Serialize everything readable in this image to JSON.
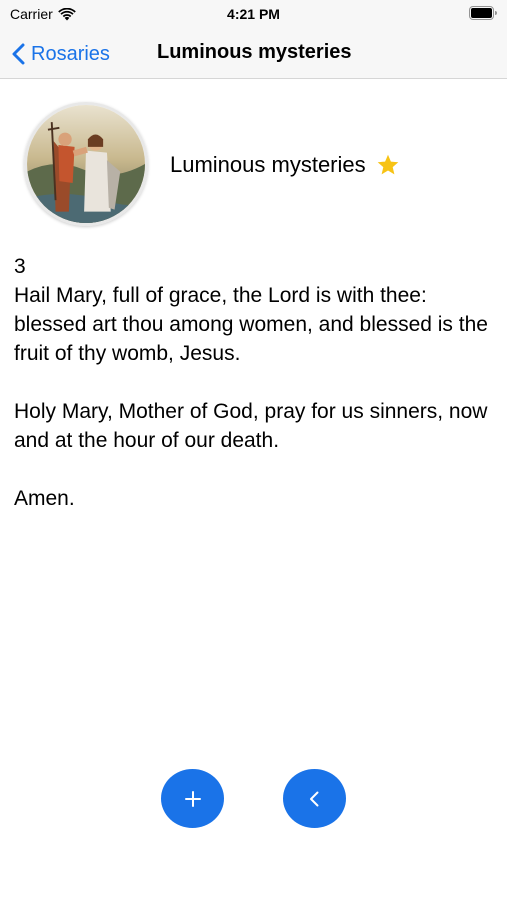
{
  "status_bar": {
    "carrier": "Carrier",
    "time": "4:21 PM"
  },
  "nav": {
    "back_label": "Rosaries",
    "title": "Luminous mysteries"
  },
  "header": {
    "mystery_title": "Luminous mysteries",
    "favorite_icon": "star-icon",
    "favorite_color": "#f7c315"
  },
  "prayer": {
    "bead_number": "3",
    "paragraph_1": "Hail Mary, full of grace, the Lord is with thee: blessed art thou among women, and blessed is the fruit of thy womb, Jesus.",
    "paragraph_2": "Holy Mary, Mother of God, pray for us sinners, now and at the hour of our death.",
    "paragraph_3": "Amen."
  },
  "actions": {
    "add_icon": "plus-icon",
    "previous_icon": "chevron-left-icon",
    "accent_color": "#1a73e8"
  }
}
